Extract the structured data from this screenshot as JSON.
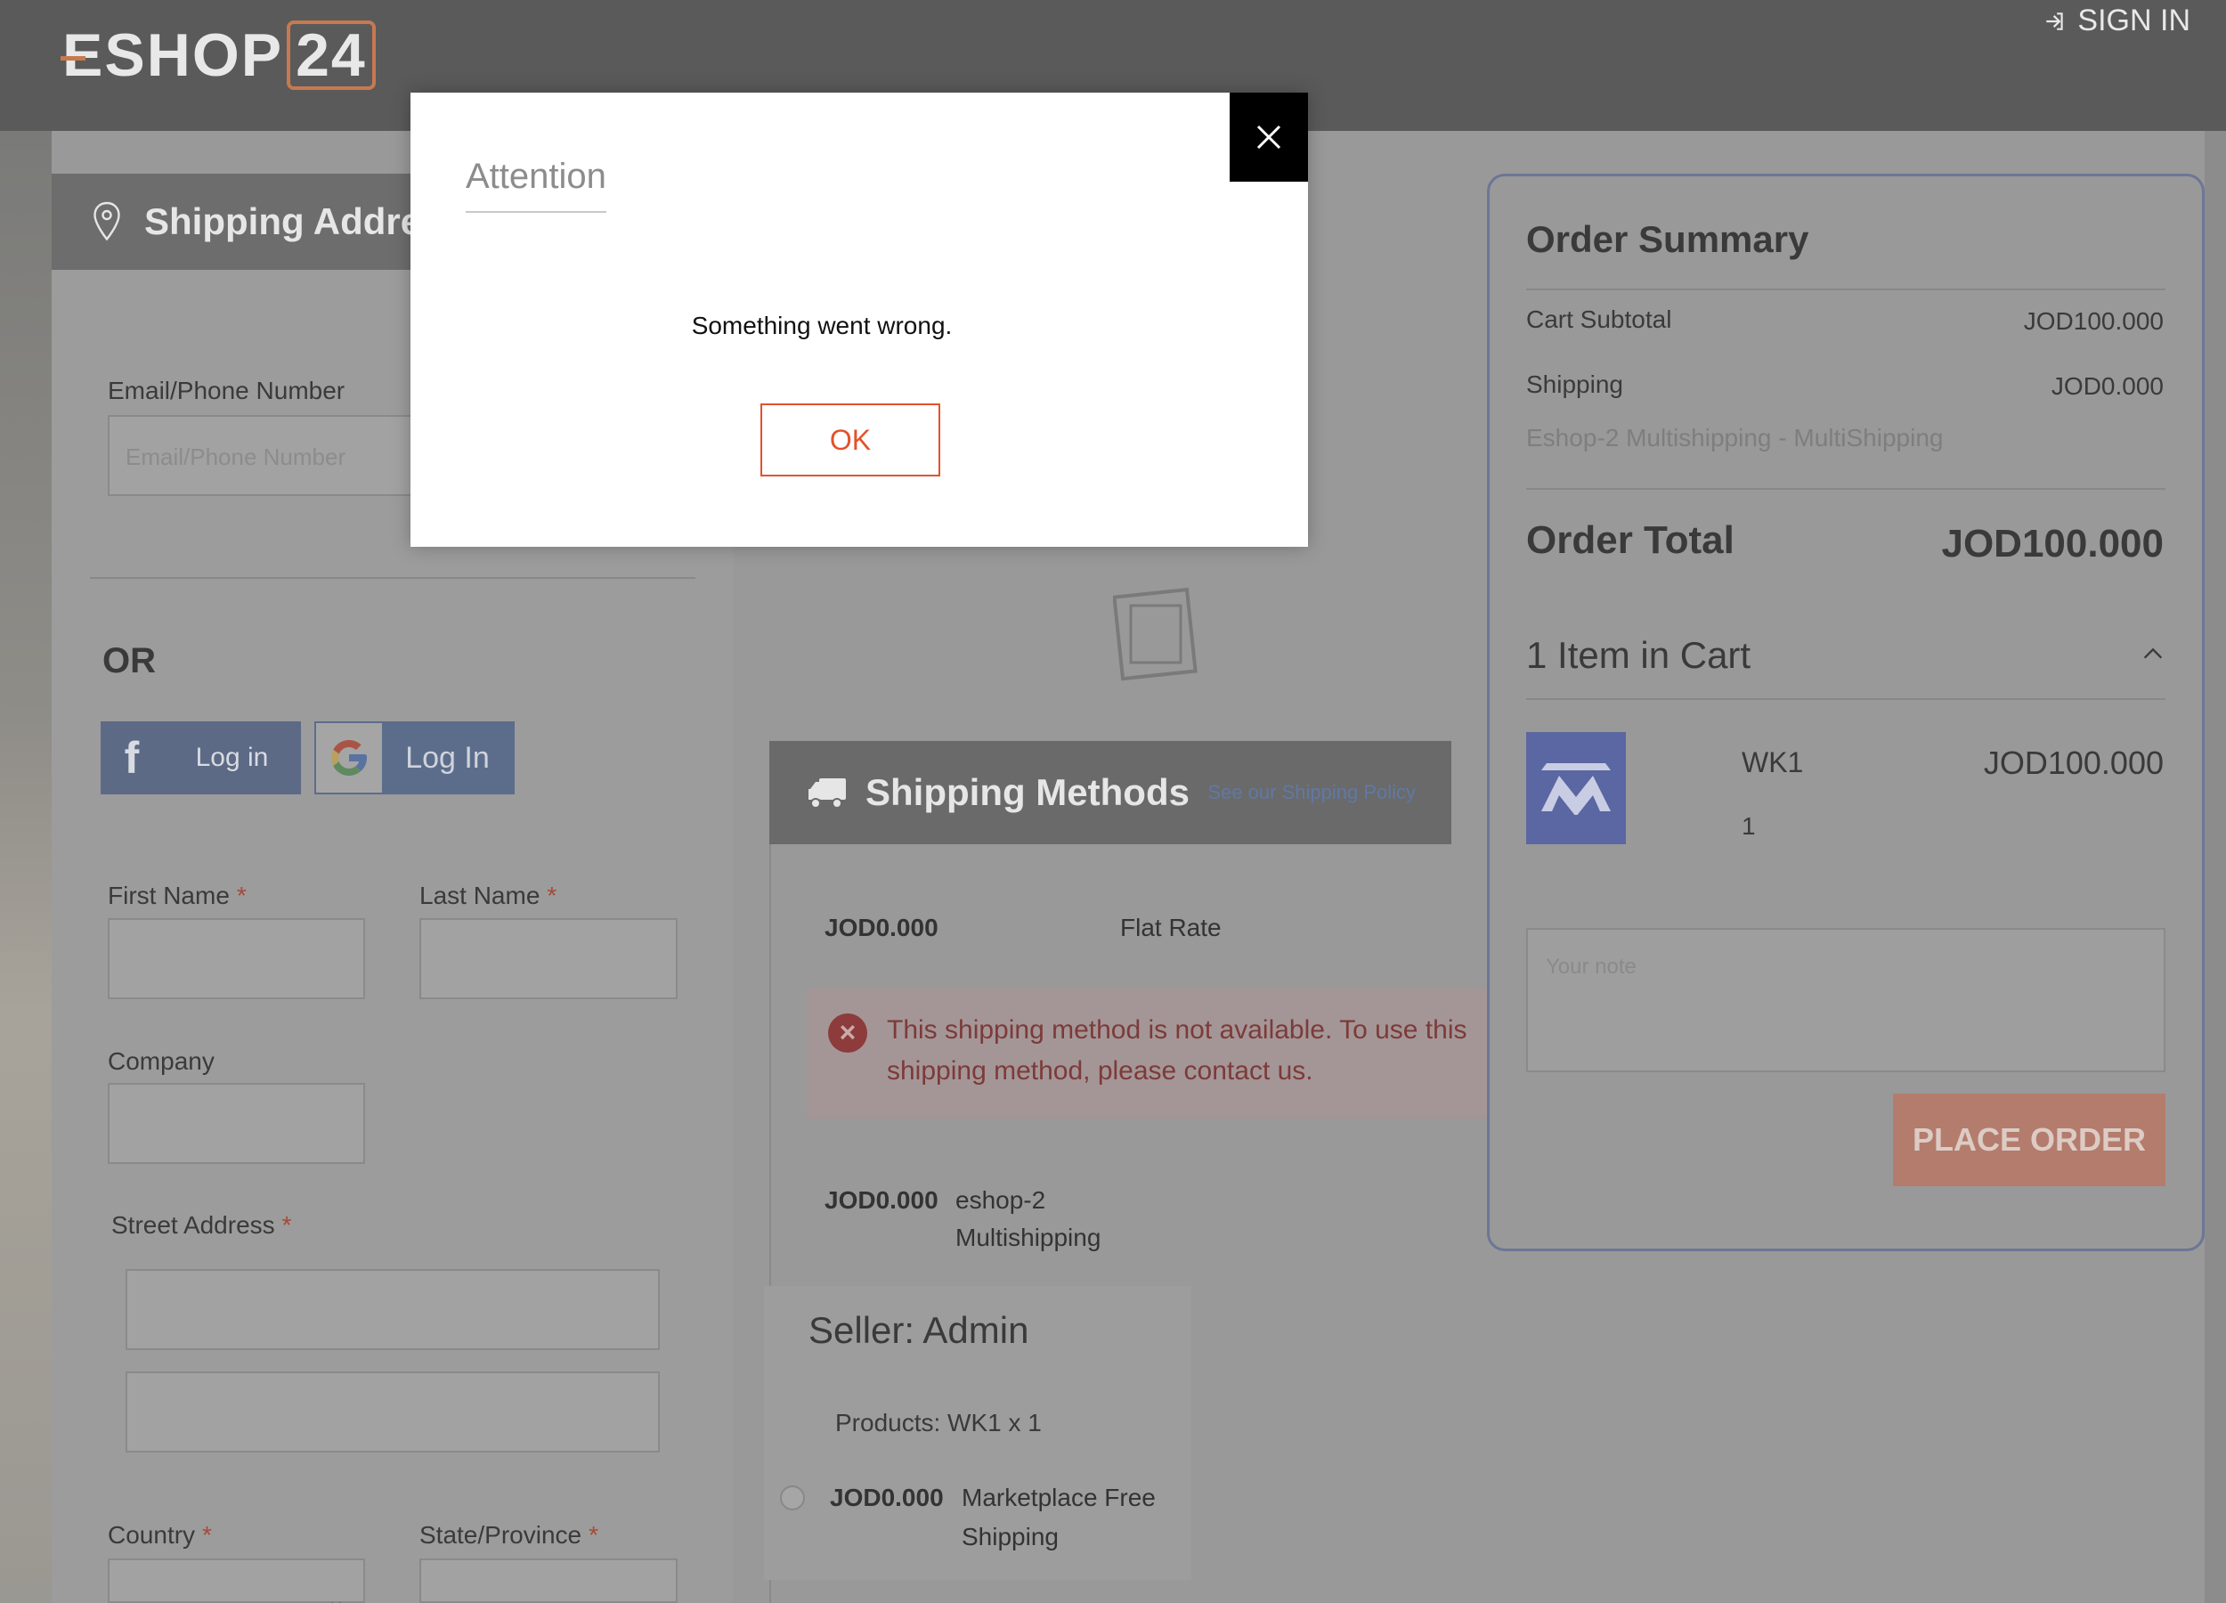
{
  "header": {
    "logo_main": "ESHOP",
    "logo_box": "24",
    "signin_label": "SIGN IN"
  },
  "shipping_address": {
    "title": "Shipping Address",
    "email_label": "Email/Phone Number",
    "email_placeholder": "Email/Phone Number",
    "or_label": "OR",
    "facebook_login": "Log in",
    "google_login": "Log In",
    "first_name_label": "First Name",
    "last_name_label": "Last Name",
    "company_label": "Company",
    "street_label": "Street Address",
    "country_label": "Country",
    "state_label": "State/Province",
    "required_mark": "*"
  },
  "shipping_methods": {
    "title": "Shipping Methods",
    "policy_link": "See our Shipping Policy",
    "methods": [
      {
        "price": "JOD0.000",
        "name": "Flat Rate"
      },
      {
        "price": "JOD0.000",
        "name_line1": "eshop-2",
        "name_line2": "Multishipping"
      }
    ],
    "error_text": "This shipping method is not available. To use this shipping method, please contact us.",
    "seller": {
      "title": "Seller: Admin",
      "products": "Products: WK1 x 1",
      "price": "JOD0.000",
      "method_line1": "Marketplace Free",
      "method_line2": "Shipping"
    }
  },
  "order_summary": {
    "title": "Order Summary",
    "subtotal_label": "Cart Subtotal",
    "subtotal_value": "JOD100.000",
    "shipping_label": "Shipping",
    "shipping_value": "JOD0.000",
    "shipping_detail": "Eshop-2 Multishipping - MultiShipping",
    "total_label": "Order Total",
    "total_value": "JOD100.000",
    "items_in_cart": "1 Item in Cart",
    "item": {
      "name": "WK1",
      "price": "JOD100.000",
      "qty": "1"
    },
    "note_placeholder": "Your note",
    "place_order": "PLACE ORDER"
  },
  "modal": {
    "title": "Attention",
    "message": "Something went wrong.",
    "ok_label": "OK"
  },
  "colors": {
    "brand_accent": "#e3522b",
    "header_bg": "#5a5a5a",
    "logo_accent": "#c67a50"
  }
}
